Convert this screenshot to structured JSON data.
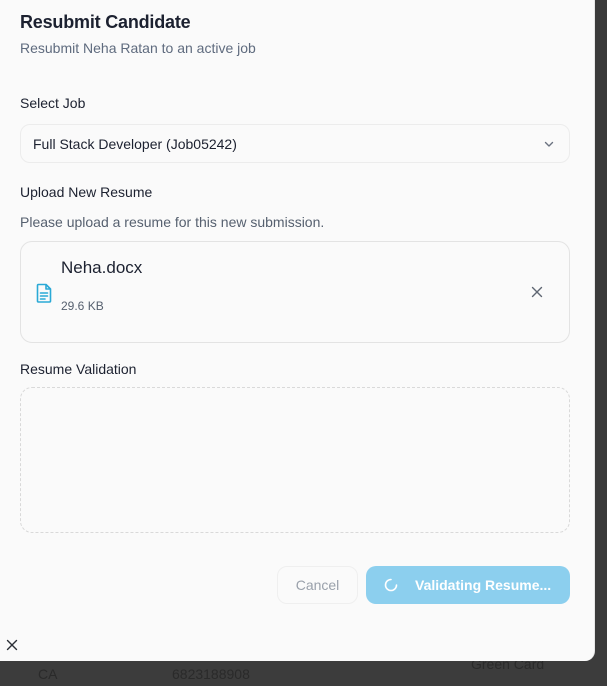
{
  "dialog": {
    "title": "Resubmit Candidate",
    "subtitle": "Resubmit Neha Ratan to an active job"
  },
  "select_job": {
    "label": "Select Job",
    "selected_value": "Full Stack Developer (Job05242)",
    "icon": "chevron-down-icon"
  },
  "upload": {
    "label": "Upload New Resume",
    "help_text": "Please upload a resume for this new submission.",
    "file": {
      "name": "Neha.docx",
      "size": "29.6 KB",
      "icon": "document-icon",
      "remove_icon": "close-icon"
    }
  },
  "validation": {
    "label": "Resume Validation"
  },
  "actions": {
    "cancel_label": "Cancel",
    "validate_label": "Validating Resume...",
    "validate_icon": "spinner-icon"
  },
  "background_row": {
    "state": "CA",
    "phone": "6823188908",
    "status": "Green Card"
  },
  "colors": {
    "accent": "#8ccfee",
    "file_icon": "#2aa9d6",
    "text_primary": "#1c2130",
    "text_secondary": "#56606f"
  }
}
